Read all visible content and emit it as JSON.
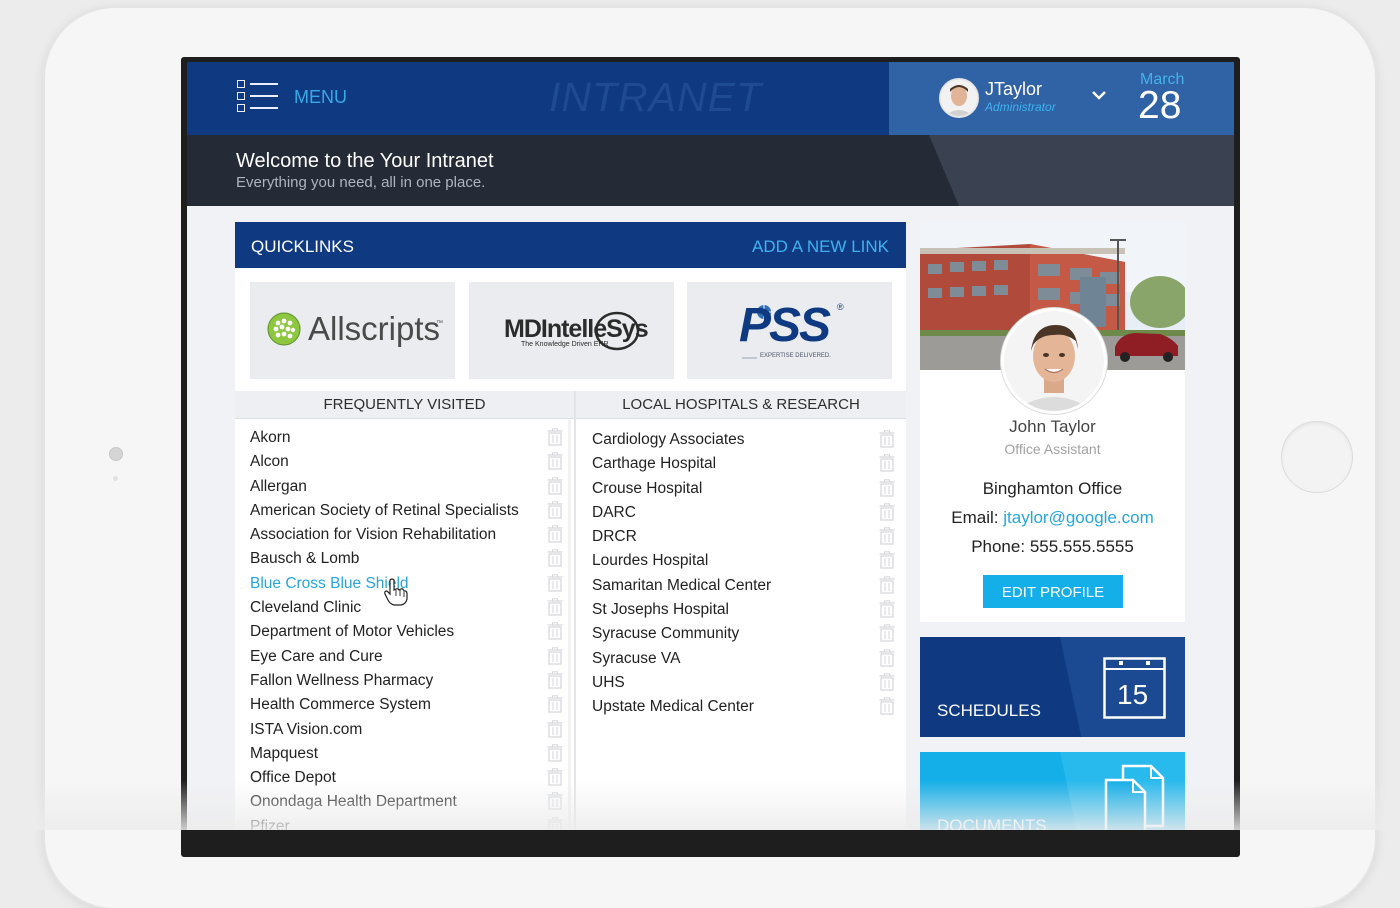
{
  "header": {
    "menu_label": "MENU",
    "watermark": "INTRANET",
    "user_name": "JTaylor",
    "user_role": "Administrator",
    "date_month": "March",
    "date_day": "28"
  },
  "welcome": {
    "title": "Welcome to the Your Intranet",
    "subtitle": "Everything you need, all in one place."
  },
  "quicklinks": {
    "title": "QUICKLINKS",
    "add_link": "ADD A NEW LINK",
    "logos": [
      {
        "name": "Allscripts",
        "tm": "™"
      },
      {
        "name": "MDIntelleSys",
        "tagline": "The Knowledge Driven EHR"
      },
      {
        "name": "PSS",
        "tagline": "EXPERTISE DELIVERED.",
        "reg": "®"
      }
    ]
  },
  "frequently_visited": {
    "heading": "FREQUENTLY VISITED",
    "items": [
      "Akorn",
      "Alcon",
      "Allergan",
      "American Society of Retinal Specialists",
      "Association for Vision Rehabilitation",
      "Bausch & Lomb",
      "Blue Cross Blue Shield",
      "Cleveland Clinic",
      "Department of Motor Vehicles",
      "Eye Care and Cure",
      "Fallon Wellness Pharmacy",
      "Health Commerce System",
      "ISTA Vision.com",
      "Mapquest",
      "Office Depot",
      "Onondaga Health Department",
      "Pfizer"
    ],
    "active_index": 6
  },
  "local_hospitals": {
    "heading": "LOCAL HOSPITALS & RESEARCH",
    "items": [
      "Cardiology Associates",
      "Carthage Hospital",
      "Crouse Hospital",
      "DARC",
      "DRCR",
      "Lourdes Hospital",
      "Samaritan Medical Center",
      "St Josephs Hospital",
      "Syracuse Community",
      "Syracuse VA",
      "UHS",
      "Upstate Medical Center"
    ]
  },
  "profile": {
    "name": "John Taylor",
    "role": "Office Assistant",
    "office": "Binghamton Office",
    "email_label": "Email:",
    "email": "jtaylor@google.com",
    "phone_label": "Phone:",
    "phone": "555.555.5555",
    "edit_button": "EDIT PROFILE"
  },
  "tiles": {
    "schedules": {
      "label": "SCHEDULES",
      "calendar_number": "15"
    },
    "documents": {
      "label": "DOCUMENTS"
    }
  },
  "colors": {
    "navy": "#0f3a82",
    "accent_blue": "#14aee8",
    "link_blue": "#26a6dc",
    "welcome_band": "#242a36"
  }
}
